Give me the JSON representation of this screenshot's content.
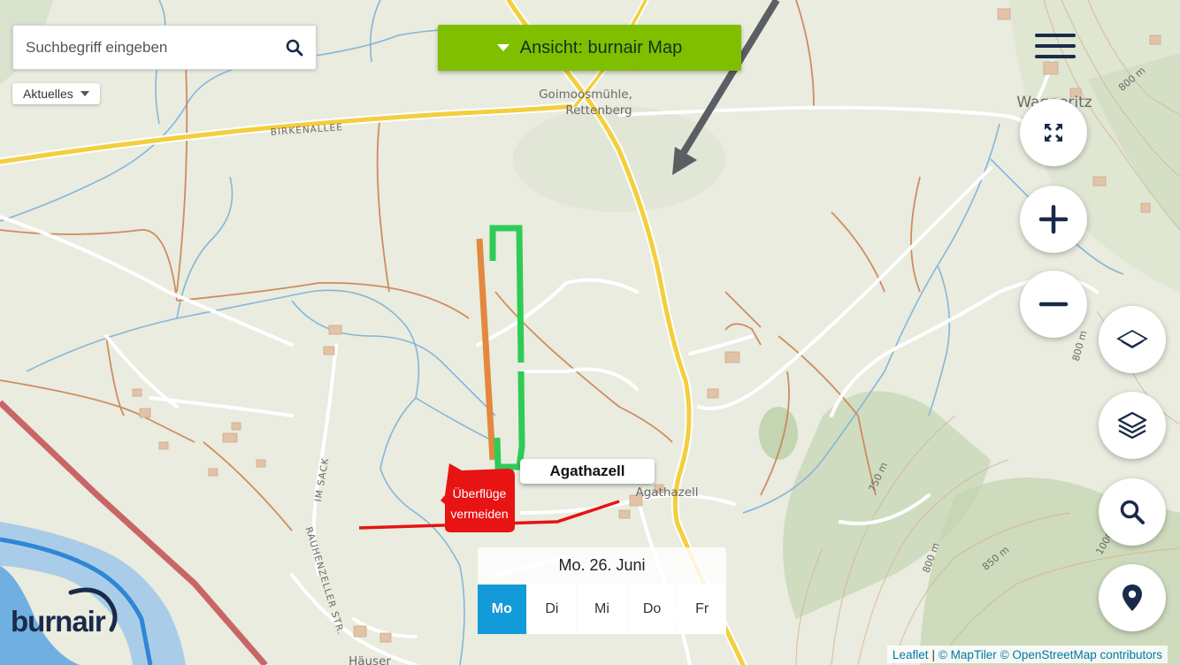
{
  "search": {
    "placeholder": "Suchbegriff eingeben"
  },
  "filter": {
    "label": "Aktuelles"
  },
  "view_selector": {
    "label": "Ansicht: burnair Map"
  },
  "map": {
    "place_labels": [
      {
        "name": "goimoosmuehle",
        "text": "Goimoosmühle,"
      },
      {
        "name": "rettenberg",
        "text": "Rettenberg"
      },
      {
        "name": "wagneritz",
        "text": "Wagneritz"
      },
      {
        "name": "agathazell",
        "text": "Agathazell"
      },
      {
        "name": "haeuser",
        "text": "Häuser"
      }
    ],
    "street_labels": [
      {
        "name": "birkenallee",
        "text": "BIRKENALLEE"
      },
      {
        "name": "im-sack",
        "text": "IM SACK"
      },
      {
        "name": "rauhenzeller-str",
        "text": "RAUHENZELLER STR."
      }
    ],
    "contour_labels": [
      {
        "name": "contour-800-a",
        "text": "800 m"
      },
      {
        "name": "contour-800-b",
        "text": "800 m"
      },
      {
        "name": "contour-750",
        "text": "750 m"
      },
      {
        "name": "contour-800-c",
        "text": "800 m"
      },
      {
        "name": "contour-850",
        "text": "850 m"
      },
      {
        "name": "contour-1000",
        "text": "1000"
      }
    ],
    "highlighted_place": "Agathazell",
    "warning": {
      "line1": "Überflüge",
      "line2": "vermeiden"
    },
    "colors": {
      "landing_zone": "#2ecc55",
      "approach_line": "#e3883e",
      "no_fly": "#e81313",
      "wind_arrow": "#5b5e63"
    }
  },
  "controls": {
    "fullscreen": "fullscreen-icon",
    "zoom_in": "plus-icon",
    "zoom_out": "minus-icon",
    "layer_toggle": "layer-icon",
    "layers": "layers-stack-icon",
    "search": "search-icon",
    "locate": "location-pin-icon"
  },
  "date_picker": {
    "title": "Mo. 26. Juni",
    "days": [
      "Mo",
      "Di",
      "Mi",
      "Do",
      "Fr"
    ],
    "selected": "Mo"
  },
  "logo": {
    "text": "burnair"
  },
  "attribution": {
    "leaflet": "Leaflet",
    "sep": "|",
    "maptiler": "© MapTiler",
    "osm": "© OpenStreetMap contributors"
  }
}
